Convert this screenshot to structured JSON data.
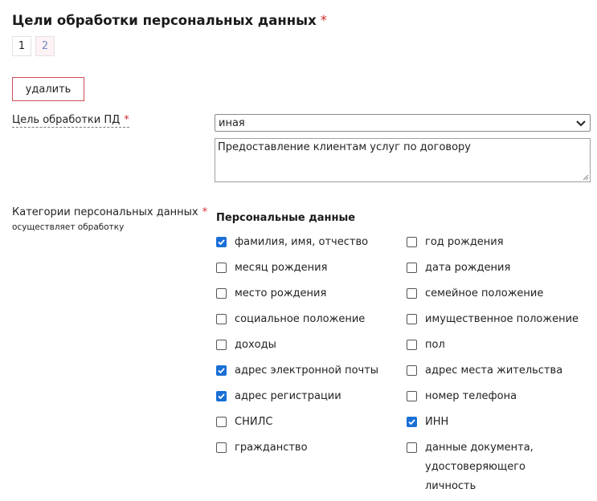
{
  "title": "Цели обработки персональных данных",
  "required_mark": "*",
  "pages": [
    "1",
    "2"
  ],
  "delete_label": "удалить",
  "purpose_label": "Цель обработки ПД",
  "purpose_select_value": "иная",
  "purpose_text": "Предоставление клиентам услуг по договору",
  "categories_label": "Категории персональных данных",
  "categories_sublabel": "осуществляет обработку",
  "section_title": "Персональные данные",
  "options": [
    {
      "label": "фамилия, имя, отчество",
      "checked": true
    },
    {
      "label": "год рождения",
      "checked": false
    },
    {
      "label": "месяц рождения",
      "checked": false
    },
    {
      "label": "дата рождения",
      "checked": false
    },
    {
      "label": "место рождения",
      "checked": false
    },
    {
      "label": "семейное положение",
      "checked": false
    },
    {
      "label": "социальное положение",
      "checked": false
    },
    {
      "label": "имущественное положение",
      "checked": false
    },
    {
      "label": "доходы",
      "checked": false
    },
    {
      "label": "пол",
      "checked": false
    },
    {
      "label": "адрес электронной почты",
      "checked": true
    },
    {
      "label": "адрес места жительства",
      "checked": false
    },
    {
      "label": "адрес регистрации",
      "checked": true
    },
    {
      "label": "номер телефона",
      "checked": false
    },
    {
      "label": "СНИЛС",
      "checked": false
    },
    {
      "label": "ИНН",
      "checked": true
    },
    {
      "label": "гражданство",
      "checked": false
    },
    {
      "label": "данные документа, удостоверяющего личность",
      "checked": false
    }
  ],
  "colors": {
    "accent": "#1a6fd6",
    "required": "#d32f2f",
    "delete_border": "#d14b55"
  }
}
